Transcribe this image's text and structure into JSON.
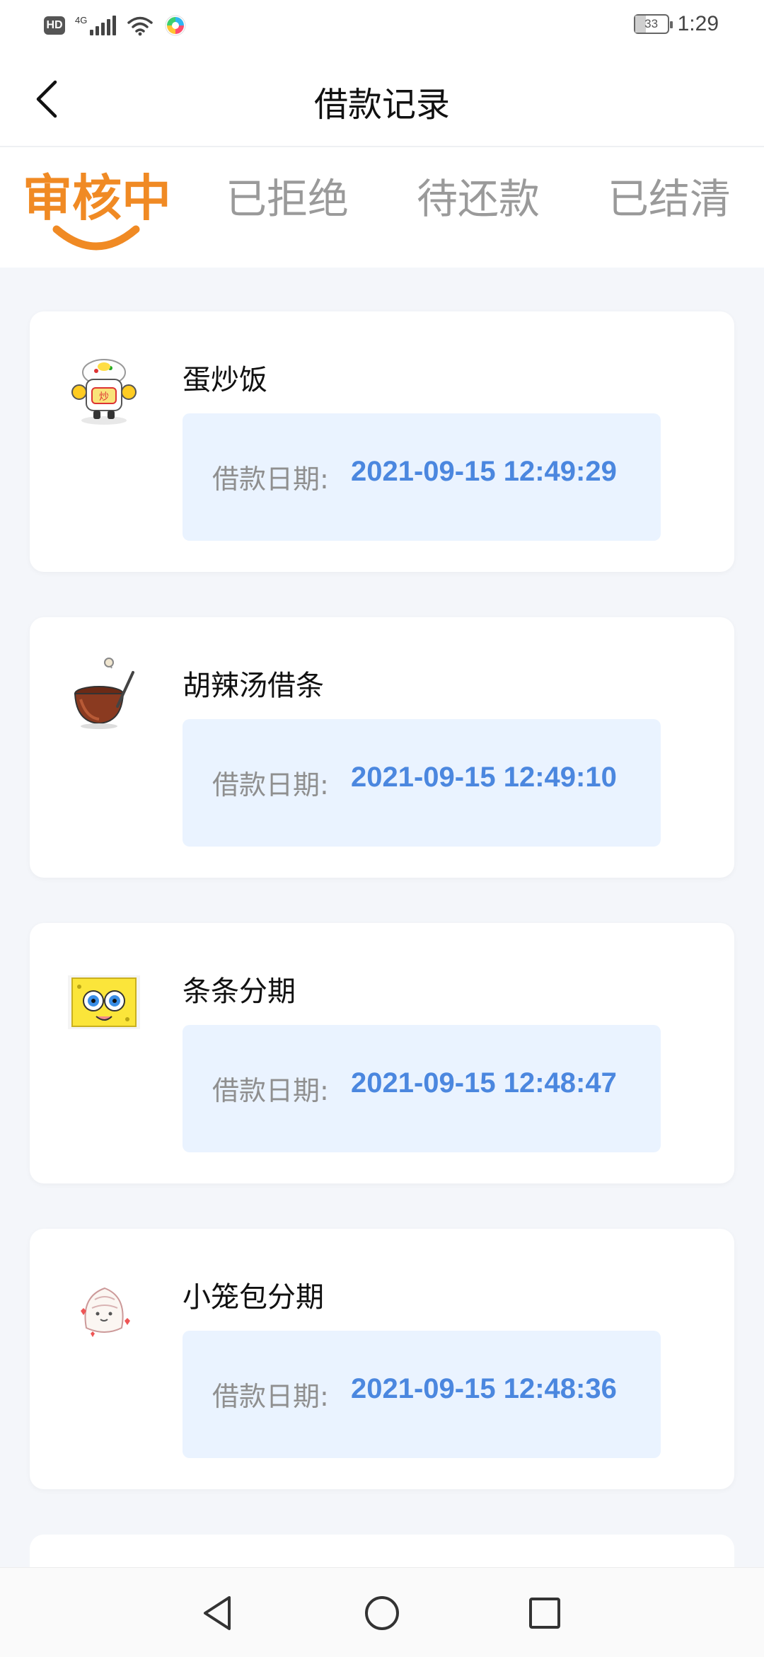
{
  "status_bar": {
    "hd": "HD",
    "network": "4G",
    "battery": "33",
    "time": "1:29"
  },
  "header": {
    "title": "借款记录"
  },
  "tabs": [
    {
      "label": "审核中",
      "active": true
    },
    {
      "label": "已拒绝",
      "active": false
    },
    {
      "label": "待还款",
      "active": false
    },
    {
      "label": "已结清",
      "active": false
    }
  ],
  "records": [
    {
      "name": "蛋炒饭",
      "date_label": "借款日期:",
      "date": "2021-09-15 12:49:29",
      "logo_icon": "fried-rice-mascot-icon"
    },
    {
      "name": "胡辣汤借条",
      "date_label": "借款日期:",
      "date": "2021-09-15 12:49:10",
      "logo_icon": "soup-bowl-icon"
    },
    {
      "name": "条条分期",
      "date_label": "借款日期:",
      "date": "2021-09-15 12:48:47",
      "logo_icon": "sponge-face-icon"
    },
    {
      "name": "小笼包分期",
      "date_label": "借款日期:",
      "date": "2021-09-15 12:48:36",
      "logo_icon": "dumpling-icon"
    }
  ],
  "colors": {
    "accent_orange": "#f08a24",
    "date_blue": "#4b87df",
    "date_box_bg": "#eaf3ff",
    "page_bg": "#f4f6fa"
  }
}
